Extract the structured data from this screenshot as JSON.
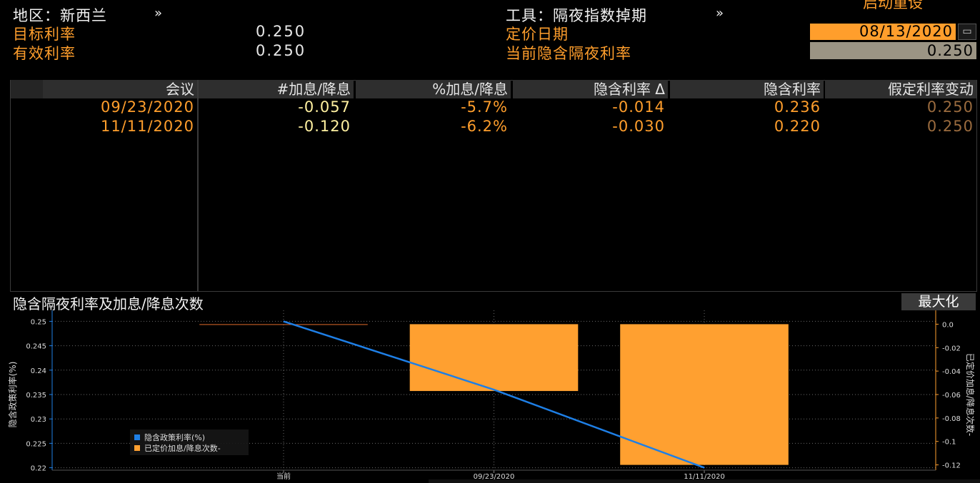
{
  "header": {
    "region_label": "地区：新西兰",
    "region_arrow": "»",
    "instrument_label": "工具：隔夜指数掉期",
    "instrument_arrow": "»",
    "target_rate_label": "目标利率",
    "target_rate_value": "0.250",
    "effective_rate_label": "有效利率",
    "effective_rate_value": "0.250",
    "pricing_date_label": "定价日期",
    "pricing_date_value": "08/13/2020",
    "implied_overnight_label": "当前隐含隔夜利率",
    "implied_overnight_value": "0.250",
    "calendar_icon": "calendar-icon",
    "top_right_partial": "启动重设"
  },
  "table": {
    "columns": [
      "会议",
      "#加息/降息",
      "%加息/降息",
      "隐含利率 Δ",
      "隐含利率",
      "假定利率变动"
    ],
    "rows": [
      [
        "09/23/2020",
        "-0.057",
        "-5.7%",
        "-0.014",
        "0.236",
        "0.250"
      ],
      [
        "11/11/2020",
        "-0.120",
        "-6.2%",
        "-0.030",
        "0.220",
        "0.250"
      ]
    ]
  },
  "chart_section": {
    "title": "隐含隔夜利率及加息/降息次数",
    "maximize_label": "最大化"
  },
  "chart_data": {
    "type": "bar",
    "title": "",
    "categories": [
      "当前",
      "09/23/2020",
      "11/11/2020"
    ],
    "series": [
      {
        "name": "隐含政策利率(%)",
        "type": "line",
        "axis": "left",
        "color": "#1e7fe6",
        "values": [
          0.25,
          0.236,
          0.22
        ]
      },
      {
        "name": "已定价加息/降息次数-",
        "type": "bar",
        "axis": "right",
        "color": "#ffa030",
        "values": [
          0.0,
          -0.057,
          -0.12
        ]
      }
    ],
    "ylabel": "隐含政策利率(%)",
    "y2label": "已定价加息/降息次数-",
    "ylim": [
      0.2195,
      0.2505
    ],
    "y2lim": [
      -0.1245,
      0.0045
    ],
    "yticks": [
      "0.25",
      "0.245",
      "0.24",
      "0.235",
      "0.23",
      "0.225",
      "0.22"
    ],
    "y2ticks": [
      "0.0",
      "-0.02",
      "-0.04",
      "-0.06",
      "-0.08",
      "-0.1",
      "-0.12"
    ],
    "grid": true,
    "legend_position": "bottom-left"
  }
}
